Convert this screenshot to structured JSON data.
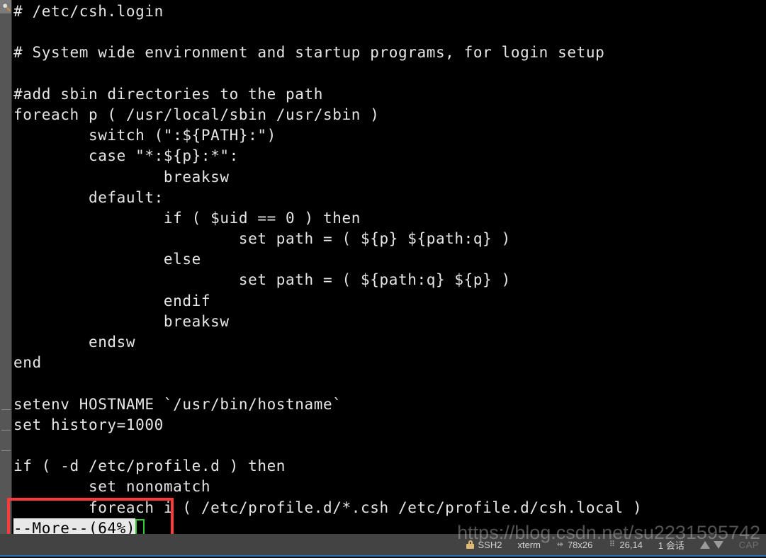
{
  "app": {
    "title": "xterm SSH2 terminal session",
    "background": "#000000",
    "foreground": "#e6e6e6"
  },
  "sidebar": {
    "icon": "search-icon",
    "background": "#565656"
  },
  "terminal": {
    "prompt_state": "more-pager",
    "font_size_px": 21,
    "lines": [
      "# /etc/csh.login",
      "",
      "# System wide environment and startup programs, for login setup",
      "",
      "#add sbin directories to the path",
      "foreach p ( /usr/local/sbin /usr/sbin )",
      "        switch (\":${PATH}:\")",
      "        case \"*:${p}:*\":",
      "                breaksw",
      "        default:",
      "                if ( $uid == 0 ) then",
      "                        set path = ( ${p} ${path:q} )",
      "                else",
      "                        set path = ( ${path:q} ${p} )",
      "                endif",
      "                breaksw",
      "        endsw",
      "end",
      "",
      "setenv HOSTNAME `/usr/bin/hostname`",
      "set history=1000",
      "",
      "if ( -d /etc/profile.d ) then",
      "        set nonomatch",
      "        foreach i ( /etc/profile.d/*.csh /etc/profile.d/csh.local )"
    ],
    "pager": {
      "label": "--More--(64%)",
      "percent": "64%",
      "reverse_video": true,
      "cursor_color": "#2ecc2e"
    }
  },
  "annotation": {
    "shape": "rectangle",
    "color": "#fb3b3b",
    "target": "--More--(64%)"
  },
  "statusbar": {
    "background": "#434343",
    "items": [
      {
        "name": "ssh-protocol",
        "icon": "lock-icon",
        "label": "SSH2"
      },
      {
        "name": "terminal-emulation",
        "icon": "",
        "label": "xterm"
      },
      {
        "name": "terminal-size",
        "icon": "resize-icon",
        "label": "78x26"
      },
      {
        "name": "cursor-position",
        "icon": "grid-icon",
        "label": "26,14"
      },
      {
        "name": "session-count",
        "icon": "",
        "label": "1 会话"
      }
    ],
    "traffic_up_icon": "arrow-up-icon",
    "traffic_down_icon": "arrow-down-icon",
    "caps_label": "CAP"
  },
  "watermark": {
    "text": "https://blog.csdn.net/su2231595742"
  }
}
